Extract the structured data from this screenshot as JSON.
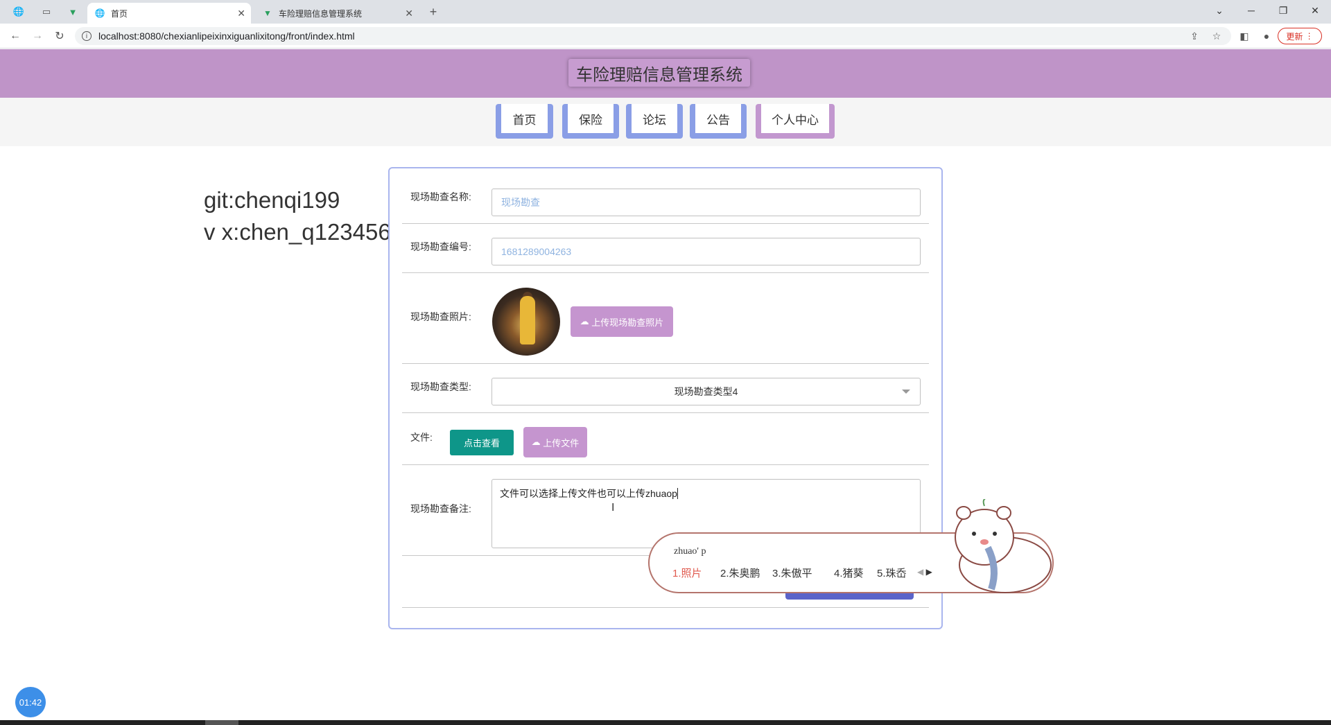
{
  "browser": {
    "tabs": [
      {
        "title": "首页",
        "active": true
      },
      {
        "title": "车险理赔信息管理系统",
        "active": false
      }
    ],
    "url": "localhost:8080/chexianlipeixinxiguanlixitong/front/index.html",
    "update_label": "更新"
  },
  "site": {
    "title": "车险理赔信息管理系统",
    "nav": [
      "首页",
      "保险",
      "论坛",
      "公告",
      "个人中心"
    ]
  },
  "watermark": {
    "line1": "git:chenqi199",
    "line2": "v x:chen_q123456"
  },
  "form": {
    "name_label": "现场勘查名称:",
    "name_placeholder": "现场勘查",
    "number_label": "现场勘查编号:",
    "number_value": "1681289004263",
    "photo_label": "现场勘查照片:",
    "photo_upload_label": "上传现场勘查照片",
    "type_label": "现场勘查类型:",
    "type_value": "现场勘查类型4",
    "file_label": "文件:",
    "view_label": "点击查看",
    "file_upload_label": "上传文件",
    "remark_label": "现场勘查备注:",
    "remark_value": "文件可以选择上传文件也可以上传zhuaop"
  },
  "ime": {
    "composition": "zhuao' p",
    "candidates": [
      "1.照片",
      "2.朱奥鹏",
      "3.朱傲平",
      "4.猪葵",
      "5.珠岙"
    ]
  },
  "timer": "01:42",
  "colors": {
    "header": "#bf94c8",
    "nav_button": "#8a9ee6",
    "teal_button": "#0e9689",
    "upload_button": "#c595cf"
  }
}
